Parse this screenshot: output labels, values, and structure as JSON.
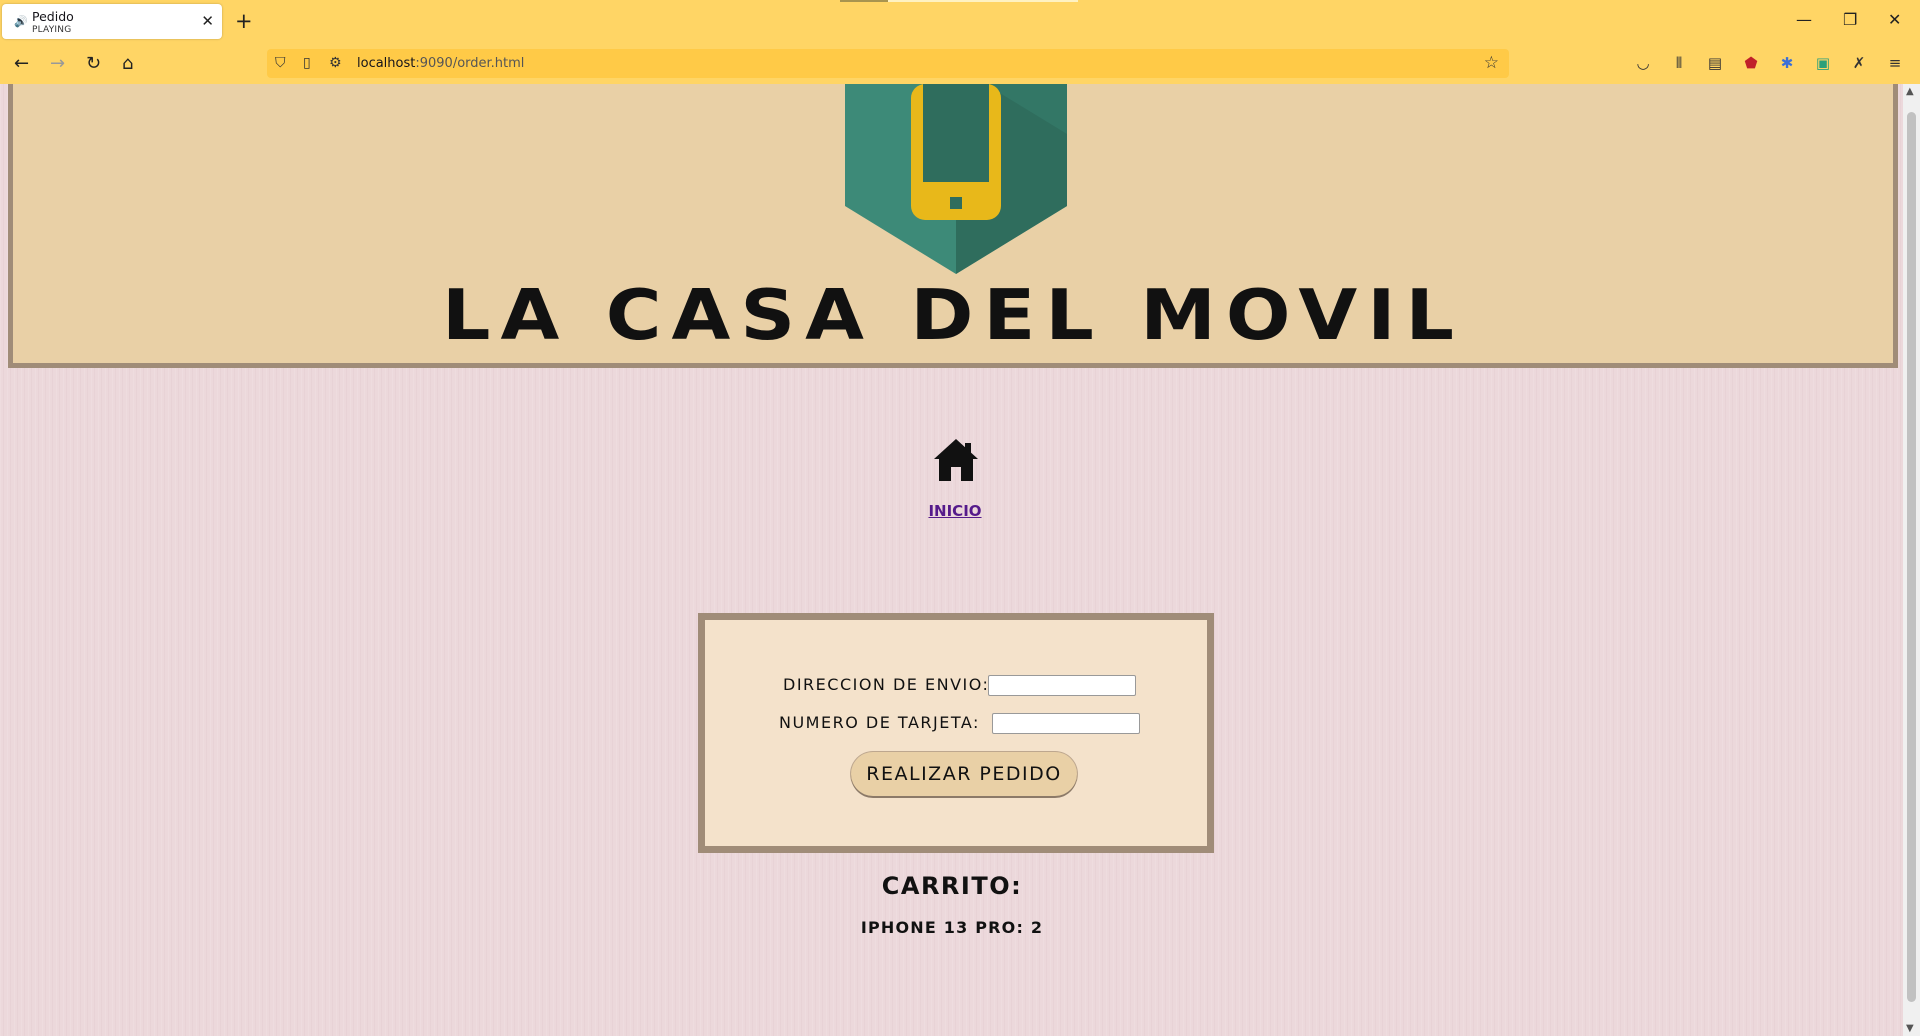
{
  "browser": {
    "tab": {
      "title": "Pedido",
      "status": "PLAYING"
    },
    "url_host": "localhost",
    "url_rest": ":9090/order.html"
  },
  "header": {
    "brand": "LA CASA DEL MOVIL"
  },
  "nav": {
    "home_label": "INICIO"
  },
  "order_form": {
    "address_label": "DIRECCION DE ENVIO:",
    "address_value": "",
    "card_label": "NUMERO DE TARJETA:",
    "card_value": "",
    "submit_label": "REALIZAR PEDIDO"
  },
  "cart": {
    "title": "CARRITO:",
    "items": [
      "IPHONE 13 PRO: 2"
    ]
  },
  "colors": {
    "chrome": "#ffd565",
    "header_bg": "#e9d0a6",
    "frame": "#a08c78",
    "page_bg": "#ecd8db",
    "link": "#551a8b"
  }
}
